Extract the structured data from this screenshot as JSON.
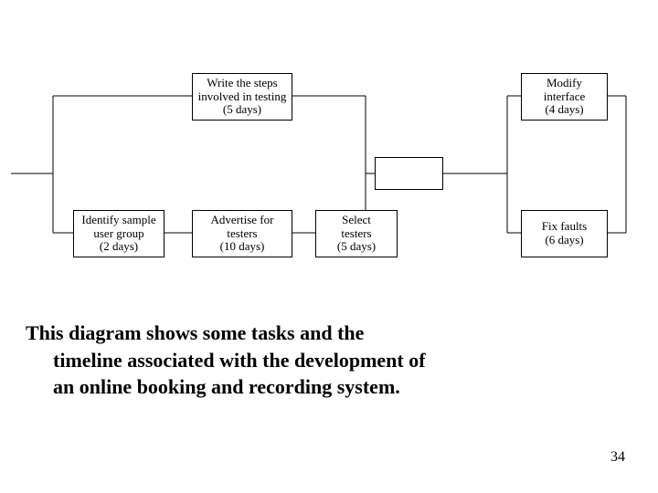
{
  "boxes": {
    "writeSteps": {
      "line1": "Write the steps",
      "line2": "involved in testing",
      "duration": "(5 days)"
    },
    "modifyInterface": {
      "line1": "Modify",
      "line2": "interface",
      "duration": "(4 days)"
    },
    "identifyGroup": {
      "line1": "Identify sample",
      "line2": "user group",
      "duration": "(2 days)"
    },
    "advertise": {
      "line1": "Advertise for",
      "line2": "testers",
      "duration": "(10 days)"
    },
    "selectTesters": {
      "line1": "Select",
      "line2": "testers",
      "duration": "(5 days)"
    },
    "fixFaults": {
      "line1": "Fix faults",
      "duration": "(6 days)"
    }
  },
  "caption": {
    "l1": "This diagram shows some tasks and the",
    "l2": "timeline associated with the development of",
    "l3": "an  online booking and recording system."
  },
  "pageNumber": "34"
}
